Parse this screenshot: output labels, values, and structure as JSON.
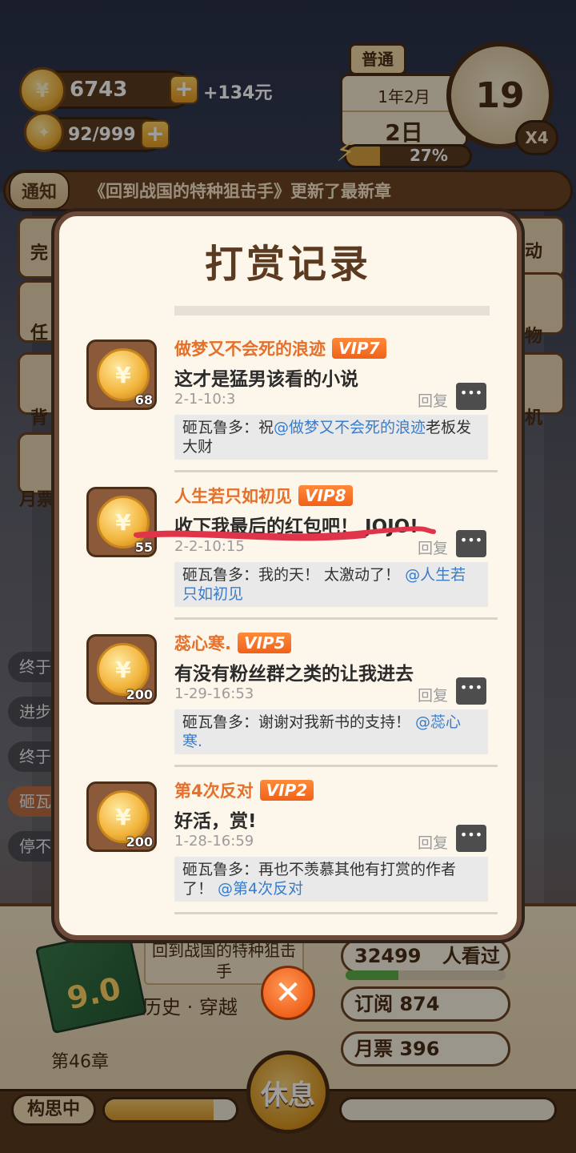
{
  "header": {
    "coins": "6743",
    "coins_gain": "+134元",
    "energy": "92/999",
    "plus": "+"
  },
  "calendar": {
    "mode": "普通",
    "year_month": "1年2月",
    "day": "2日",
    "clock_value": "19",
    "speed": "X4",
    "progress_label": "27%",
    "progress_value": 0.27
  },
  "notice": {
    "tag": "通知",
    "text": "《回到战国的特种狙击手》更新了最新章"
  },
  "side_menu": {
    "left_items": [
      "完",
      "任",
      "背",
      "月票"
    ],
    "right_items": [
      "动",
      "物",
      "机"
    ],
    "chips": [
      "终于",
      "进步",
      "终于",
      "砸瓦",
      "停不"
    ]
  },
  "modal": {
    "title": "打赏记录",
    "records": [
      {
        "count": "68",
        "name": "做梦又不会死的浪迹",
        "vip": "VIP7",
        "message": "这才是猛男该看的小说",
        "time": "2-1-10:3",
        "reply_label": "回复",
        "reply_author": "砸瓦鲁多：祝",
        "reply_mention": "@做梦又不会死的浪迹",
        "reply_tail": "老板发大财"
      },
      {
        "count": "55",
        "name": "人生若只如初见",
        "vip": "VIP8",
        "message": "收下我最后的红包吧！ JOJO!",
        "time": "2-2-10:15",
        "reply_label": "回复",
        "reply_author": "砸瓦鲁多：我的天！ 太激动了！ ",
        "reply_mention": "@人生若只如初见",
        "reply_tail": ""
      },
      {
        "count": "200",
        "name": "蕊心寒.",
        "vip": "VIP5",
        "message": "有没有粉丝群之类的让我进去",
        "time": "1-29-16:53",
        "reply_label": "回复",
        "reply_author": "砸瓦鲁多：谢谢对我新书的支持！ ",
        "reply_mention": "@蕊心寒.",
        "reply_tail": ""
      },
      {
        "count": "200",
        "name": "第4次反对",
        "vip": "VIP2",
        "message": "好活，赏!",
        "time": "1-28-16:59",
        "reply_label": "回复",
        "reply_author": "砸瓦鲁多：再也不羡慕其他有打赏的作者了！ ",
        "reply_mention": "@第4次反对",
        "reply_tail": ""
      }
    ]
  },
  "book": {
    "score": "9.0",
    "title": "回到战国的特种狙击手",
    "genre": "历史 · 穿越",
    "chapter": "第46章",
    "views": "32499",
    "views_label": "人看过",
    "views_progress": 0.33,
    "subscribe": "订阅 874",
    "monthly_ticket": "月票 396"
  },
  "status": {
    "state": "构思中",
    "rest_label": "休息",
    "left_progress": 0.83,
    "right_progress": 0.0
  },
  "icons": {
    "coin": "coin-icon",
    "bulb": "lightbulb-icon",
    "close": "close-icon",
    "comment": "comment-icon"
  },
  "colors": {
    "accent_orange": "#f0621a",
    "brown": "#5b3a20",
    "mention_blue": "#3a7cc8"
  }
}
